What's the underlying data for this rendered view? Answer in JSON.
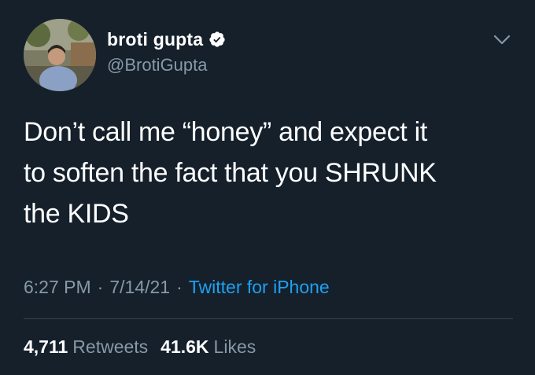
{
  "tweet": {
    "author": {
      "display_name": "broti gupta",
      "handle": "@BrotiGupta",
      "verified": true,
      "avatar_icon": "profile-photo"
    },
    "text": "Don’t call me “honey” and expect it\nto soften the fact that you SHRUNK\nthe KIDS",
    "meta": {
      "time": "6:27 PM",
      "date": "7/14/21",
      "separator": "·",
      "source": "Twitter for iPhone"
    },
    "stats": {
      "retweets_count": "4,711",
      "retweets_label": "Retweets",
      "likes_count": "41.6K",
      "likes_label": "Likes"
    }
  },
  "colors": {
    "background": "#15202b",
    "primary_text": "#ffffff",
    "secondary_text": "#8899a6",
    "link": "#1da1f2",
    "divider": "#38444d"
  },
  "icons": {
    "verified": "verified-badge-icon",
    "more": "chevron-down-icon"
  }
}
